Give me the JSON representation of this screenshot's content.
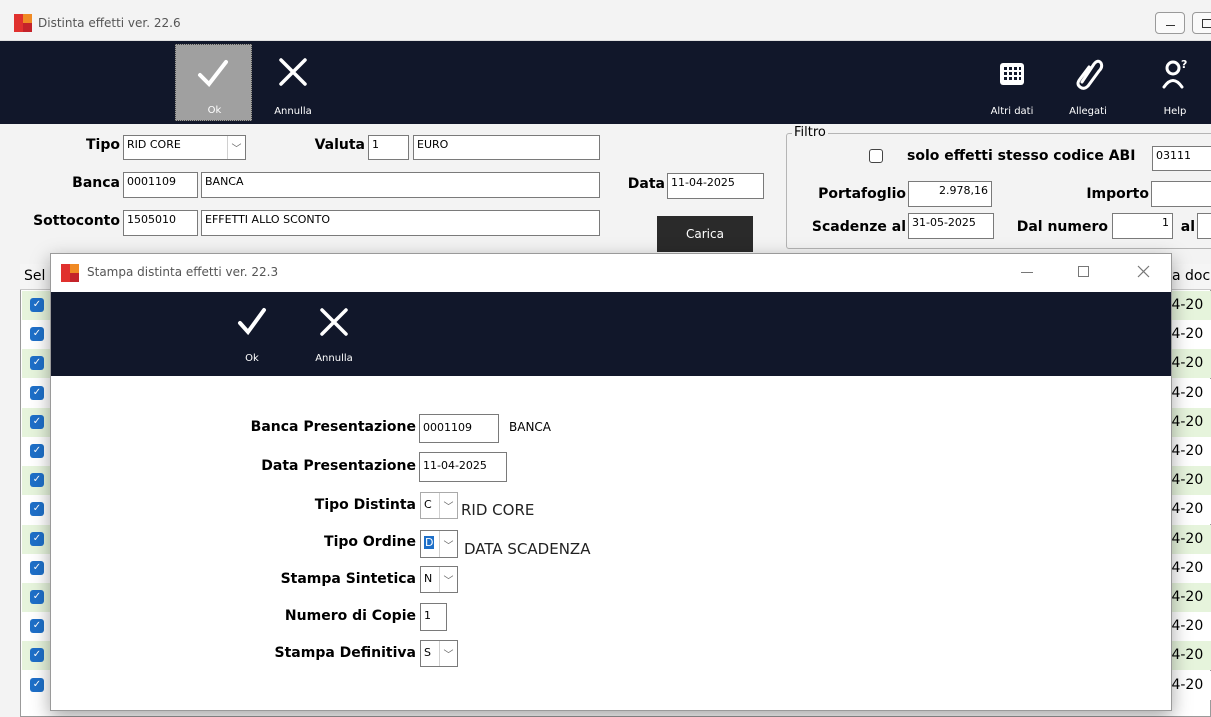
{
  "main_window": {
    "title": "Distinta effetti  ver. 22.6",
    "toolbar": {
      "ok": "Ok",
      "annulla": "Annulla",
      "altri_dati": "Altri dati",
      "allegati": "Allegati",
      "help": "Help"
    },
    "form": {
      "tipo_label": "Tipo",
      "tipo_value": "RID CORE",
      "valuta_label": "Valuta",
      "valuta_code": "1",
      "valuta_desc": "EURO",
      "banca_label": "Banca",
      "banca_code": "0001109",
      "banca_desc": "BANCA",
      "data_label": "Data",
      "data_value": "11-04-2025",
      "sottoconto_label": "Sottoconto",
      "sottoconto_code": "1505010",
      "sottoconto_desc": "EFFETTI ALLO SCONTO",
      "carica_button": "Carica"
    },
    "filtro": {
      "legend": "Filtro",
      "solo_effetti_label": "solo effetti stesso codice ABI",
      "abi_value": "03111",
      "portafoglio_label": "Portafoglio",
      "portafoglio_value": "2.978,16",
      "importo_label": "Importo",
      "importo_value": "",
      "scadenze_label": "Scadenze al",
      "scadenze_value": "31-05-2025",
      "dal_numero_label": "Dal numero",
      "dal_numero_value": "1",
      "al_label": "al",
      "al_value": ""
    },
    "grid": {
      "col_sel": "Sel",
      "col_data_doc": "a doc",
      "row_date_fragment": ")4-20",
      "rows": 14
    }
  },
  "dialog": {
    "title": "Stampa distinta effetti  ver. 22.3",
    "toolbar": {
      "ok": "Ok",
      "annulla": "Annulla"
    },
    "fields": {
      "banca_presentazione_label": "Banca Presentazione",
      "banca_presentazione_code": "0001109",
      "banca_presentazione_desc": "BANCA",
      "data_presentazione_label": "Data Presentazione",
      "data_presentazione_value": "11-04-2025",
      "tipo_distinta_label": "Tipo Distinta",
      "tipo_distinta_value": "C",
      "tipo_distinta_desc": "RID CORE",
      "tipo_ordine_label": "Tipo Ordine",
      "tipo_ordine_value": "D",
      "tipo_ordine_desc": "DATA SCADENZA",
      "stampa_sintetica_label": "Stampa Sintetica",
      "stampa_sintetica_value": "N",
      "numero_copie_label": "Numero di Copie",
      "numero_copie_value": "1",
      "stampa_definitiva_label": "Stampa Definitiva",
      "stampa_definitiva_value": "S"
    }
  }
}
